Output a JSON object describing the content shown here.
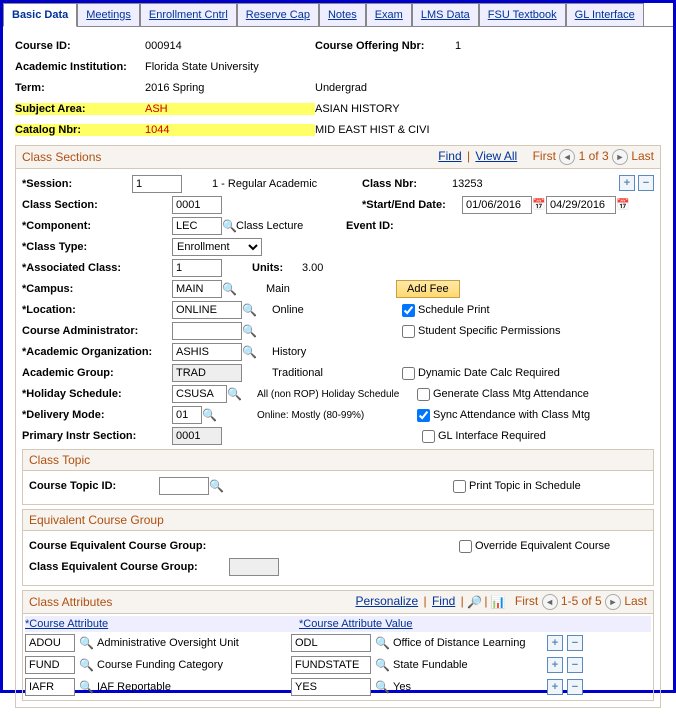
{
  "tabs": [
    "Basic Data",
    "Meetings",
    "Enrollment Cntrl",
    "Reserve Cap",
    "Notes",
    "Exam",
    "LMS Data",
    "FSU Textbook",
    "GL Interface"
  ],
  "header": {
    "course_id_lbl": "Course ID:",
    "course_id": "000914",
    "offering_lbl": "Course Offering Nbr:",
    "offering": "1",
    "inst_lbl": "Academic Institution:",
    "inst": "Florida State University",
    "term_lbl": "Term:",
    "term": "2016 Spring",
    "career": "Undergrad",
    "subj_lbl": "Subject Area:",
    "subj": "ASH",
    "subj_desc": "ASIAN HISTORY",
    "cat_lbl": "Catalog Nbr:",
    "cat": "1044",
    "cat_desc": "MID EAST HIST & CIVI"
  },
  "sections": {
    "title": "Class Sections",
    "find": "Find",
    "viewall": "View All",
    "first": "First",
    "counter": "1 of 3",
    "last": "Last",
    "session_lbl": "*Session:",
    "session": "1",
    "session_desc": "1 - Regular Academic",
    "classnbr_lbl": "Class Nbr:",
    "classnbr": "13253",
    "classsec_lbl": "Class Section:",
    "classsec": "0001",
    "dates_lbl": "*Start/End Date:",
    "start": "01/06/2016",
    "end": "04/29/2016",
    "comp_lbl": "*Component:",
    "comp": "LEC",
    "comp_desc": "Class Lecture",
    "event_lbl": "Event ID:",
    "ctype_lbl": "*Class Type:",
    "ctype": "Enrollment",
    "assoc_lbl": "*Associated Class:",
    "assoc": "1",
    "units_lbl": "Units:",
    "units": "3.00",
    "campus_lbl": "*Campus:",
    "campus": "MAIN",
    "campus_desc": "Main",
    "addfee": "Add Fee",
    "loc_lbl": "*Location:",
    "loc": "ONLINE",
    "loc_desc": "Online",
    "admin_lbl": "Course Administrator:",
    "sched_print": "Schedule Print",
    "stud_perm": "Student Specific Permissions",
    "org_lbl": "*Academic Organization:",
    "org": "ASHIS",
    "org_desc": "History",
    "grp_lbl": "Academic Group:",
    "grp": "TRAD",
    "grp_desc": "Traditional",
    "dyn_date": "Dynamic Date Calc Required",
    "gen_att": "Generate Class Mtg Attendance",
    "hol_lbl": "*Holiday Schedule:",
    "hol": "CSUSA",
    "hol_desc": "All (non ROP) Holiday Schedule",
    "sync_att": "Sync Attendance with Class Mtg",
    "gl_req": "GL Interface Required",
    "del_lbl": "*Delivery Mode:",
    "del": "01",
    "del_desc": "Online: Mostly (80-99%)",
    "prim_lbl": "Primary Instr Section:",
    "prim": "0001"
  },
  "topic": {
    "title": "Class Topic",
    "id_lbl": "Course Topic ID:",
    "print": "Print Topic in Schedule"
  },
  "equiv": {
    "title": "Equivalent Course Group",
    "course_lbl": "Course Equivalent Course Group:",
    "class_lbl": "Class Equivalent Course Group:",
    "override": "Override Equivalent Course"
  },
  "attrs": {
    "title": "Class Attributes",
    "personalize": "Personalize",
    "find": "Find",
    "first": "First",
    "counter": "1-5 of 5",
    "last": "Last",
    "h1": "*Course Attribute",
    "h2": "*Course Attribute Value",
    "rows": [
      {
        "a": "ADOU",
        "ad": "Administrative Oversight Unit",
        "v": "ODL",
        "vd": "Office of Distance Learning"
      },
      {
        "a": "FUND",
        "ad": "Course Funding Category",
        "v": "FUNDSTATE",
        "vd": "State Fundable"
      },
      {
        "a": "IAFR",
        "ad": "IAF Reportable",
        "v": "YES",
        "vd": "Yes"
      }
    ]
  }
}
